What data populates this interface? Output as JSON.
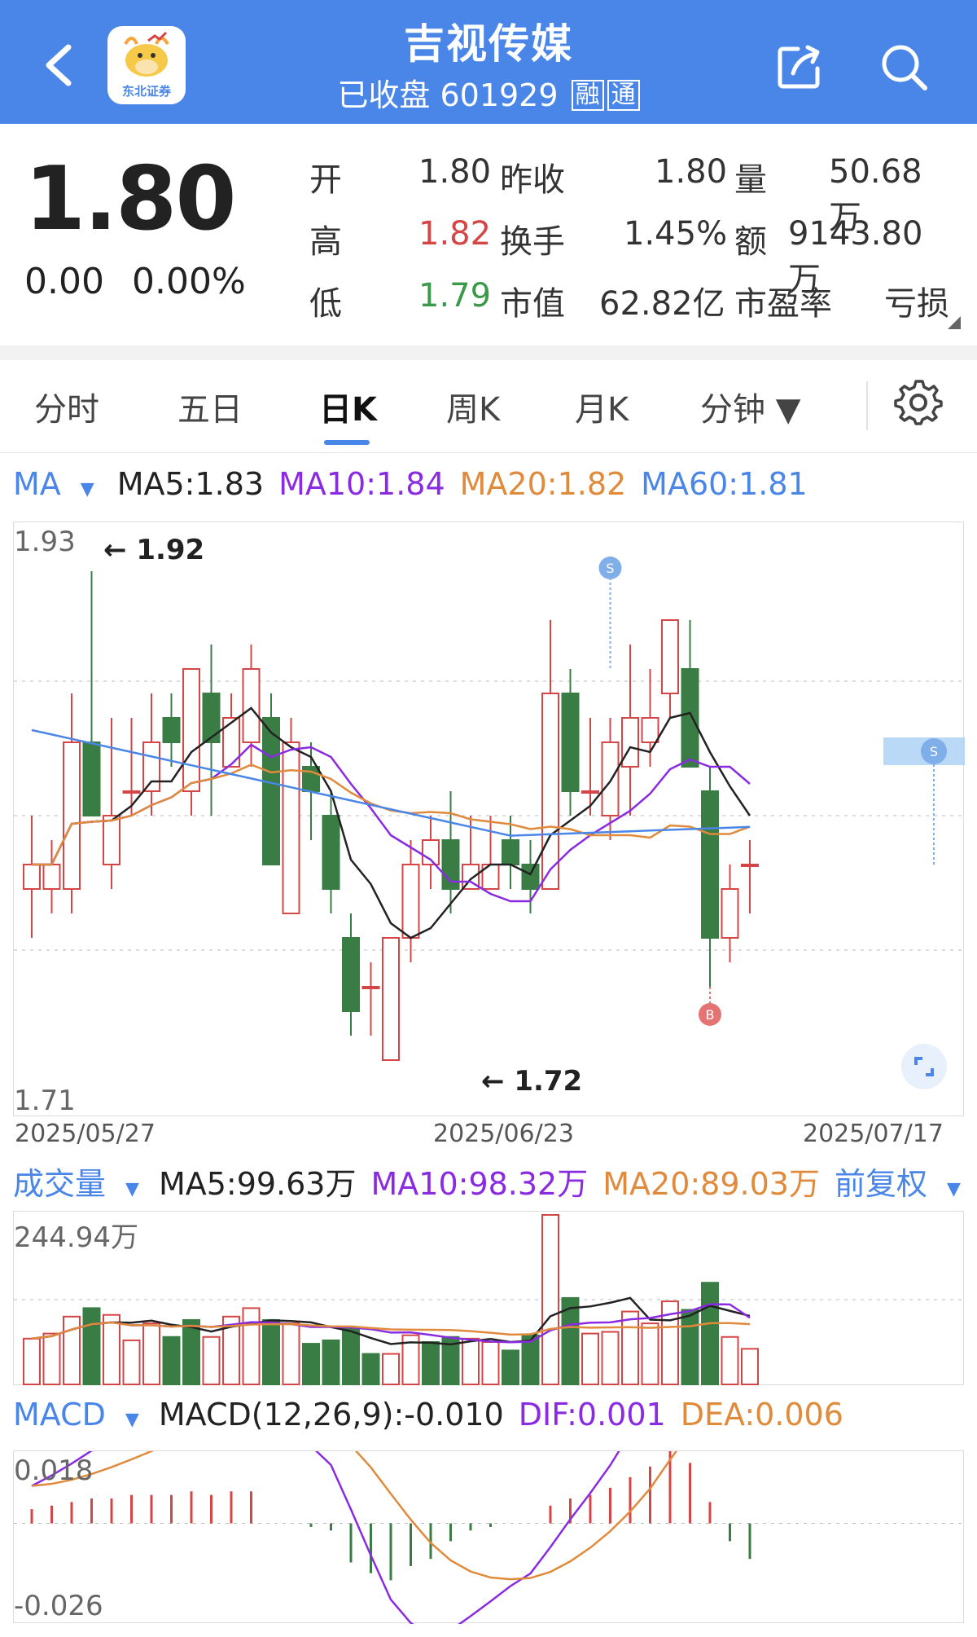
{
  "header": {
    "title": "吉视传媒",
    "status": "已收盘",
    "code": "601929",
    "tag1": "融",
    "tag2": "通",
    "logo_text": "东北证券"
  },
  "quote": {
    "price": "1.80",
    "change": "0.00",
    "change_pct": "0.00%",
    "open_label": "开",
    "open": "1.80",
    "prev_close_label": "昨收",
    "prev_close": "1.80",
    "volume_label": "量",
    "volume": "50.68万",
    "high_label": "高",
    "high": "1.82",
    "turnover_label": "换手",
    "turnover": "1.45%",
    "amount_label": "额",
    "amount": "9143.80万",
    "low_label": "低",
    "low": "1.79",
    "mktcap_label": "市值",
    "mktcap": "62.82亿",
    "pe_label": "市盈率",
    "pe": "亏损"
  },
  "tabs": [
    "分时",
    "五日",
    "日K",
    "周K",
    "月K",
    "分钟 ▼"
  ],
  "colors": {
    "up": "#d64545",
    "down": "#3a7d44",
    "ma5": "#222222",
    "ma10": "#8a2be2",
    "ma20": "#e08a3c",
    "ma60": "#4a86e8",
    "header": "#4a86e8"
  },
  "ma_legend": {
    "label": "MA",
    "ma5": "MA5:1.83",
    "ma10": "MA10:1.84",
    "ma20": "MA20:1.82",
    "ma60": "MA60:1.81"
  },
  "kline": {
    "y_max_label": "1.93",
    "y_min_label": "1.71",
    "high_mark": "1.92",
    "low_mark": "1.72",
    "dates": [
      "2025/05/27",
      "2025/06/23",
      "2025/07/17"
    ],
    "signal_s": "S",
    "signal_b": "B"
  },
  "vol_legend": {
    "label": "成交量",
    "ma5": "MA5:99.63万",
    "ma10": "MA10:98.32万",
    "ma20": "MA20:89.03万",
    "adjust": "前复权"
  },
  "vol": {
    "y_max_label": "244.94万"
  },
  "macd_legend": {
    "label": "MACD",
    "macd": "MACD(12,26,9):-0.010",
    "dif": "DIF:0.001",
    "dea": "DEA:0.006"
  },
  "macd": {
    "y_max_label": "0.018",
    "y_min_label": "-0.026"
  },
  "chart_data": {
    "type": "candlestick",
    "y_range": [
      1.71,
      1.93
    ],
    "candles": [
      {
        "o": 1.79,
        "h": 1.82,
        "l": 1.77,
        "c": 1.8
      },
      {
        "o": 1.79,
        "h": 1.81,
        "l": 1.78,
        "c": 1.8
      },
      {
        "o": 1.79,
        "h": 1.87,
        "l": 1.78,
        "c": 1.85
      },
      {
        "o": 1.85,
        "h": 1.92,
        "l": 1.82,
        "c": 1.82
      },
      {
        "o": 1.8,
        "h": 1.86,
        "l": 1.79,
        "c": 1.82
      },
      {
        "o": 1.83,
        "h": 1.86,
        "l": 1.82,
        "c": 1.83
      },
      {
        "o": 1.83,
        "h": 1.87,
        "l": 1.82,
        "c": 1.85
      },
      {
        "o": 1.86,
        "h": 1.87,
        "l": 1.84,
        "c": 1.85
      },
      {
        "o": 1.83,
        "h": 1.88,
        "l": 1.82,
        "c": 1.88
      },
      {
        "o": 1.87,
        "h": 1.89,
        "l": 1.82,
        "c": 1.85
      },
      {
        "o": 1.84,
        "h": 1.87,
        "l": 1.84,
        "c": 1.86
      },
      {
        "o": 1.85,
        "h": 1.89,
        "l": 1.84,
        "c": 1.88
      },
      {
        "o": 1.86,
        "h": 1.87,
        "l": 1.8,
        "c": 1.8
      },
      {
        "o": 1.78,
        "h": 1.86,
        "l": 1.78,
        "c": 1.85
      },
      {
        "o": 1.84,
        "h": 1.85,
        "l": 1.81,
        "c": 1.83
      },
      {
        "o": 1.82,
        "h": 1.83,
        "l": 1.78,
        "c": 1.79
      },
      {
        "o": 1.77,
        "h": 1.78,
        "l": 1.73,
        "c": 1.74
      },
      {
        "o": 1.75,
        "h": 1.76,
        "l": 1.73,
        "c": 1.75
      },
      {
        "o": 1.72,
        "h": 1.77,
        "l": 1.72,
        "c": 1.77
      },
      {
        "o": 1.77,
        "h": 1.81,
        "l": 1.76,
        "c": 1.8
      },
      {
        "o": 1.8,
        "h": 1.82,
        "l": 1.79,
        "c": 1.81
      },
      {
        "o": 1.81,
        "h": 1.83,
        "l": 1.78,
        "c": 1.79
      },
      {
        "o": 1.79,
        "h": 1.82,
        "l": 1.79,
        "c": 1.8
      },
      {
        "o": 1.79,
        "h": 1.82,
        "l": 1.79,
        "c": 1.8
      },
      {
        "o": 1.81,
        "h": 1.82,
        "l": 1.79,
        "c": 1.8
      },
      {
        "o": 1.8,
        "h": 1.81,
        "l": 1.78,
        "c": 1.79
      },
      {
        "o": 1.79,
        "h": 1.9,
        "l": 1.79,
        "c": 1.87
      },
      {
        "o": 1.87,
        "h": 1.88,
        "l": 1.82,
        "c": 1.83
      },
      {
        "o": 1.83,
        "h": 1.86,
        "l": 1.82,
        "c": 1.83
      },
      {
        "o": 1.82,
        "h": 1.86,
        "l": 1.81,
        "c": 1.85
      },
      {
        "o": 1.84,
        "h": 1.89,
        "l": 1.82,
        "c": 1.86
      },
      {
        "o": 1.85,
        "h": 1.88,
        "l": 1.84,
        "c": 1.86
      },
      {
        "o": 1.87,
        "h": 1.9,
        "l": 1.86,
        "c": 1.9
      },
      {
        "o": 1.88,
        "h": 1.9,
        "l": 1.84,
        "c": 1.84
      },
      {
        "o": 1.83,
        "h": 1.84,
        "l": 1.75,
        "c": 1.77
      },
      {
        "o": 1.77,
        "h": 1.8,
        "l": 1.76,
        "c": 1.79
      },
      {
        "o": 1.8,
        "h": 1.81,
        "l": 1.78,
        "c": 1.8
      }
    ],
    "volume": [
      {
        "v": 0.27,
        "up": true
      },
      {
        "v": 0.3,
        "up": true
      },
      {
        "v": 0.4,
        "up": true
      },
      {
        "v": 0.45,
        "up": false
      },
      {
        "v": 0.41,
        "up": true
      },
      {
        "v": 0.26,
        "up": true
      },
      {
        "v": 0.36,
        "up": true
      },
      {
        "v": 0.28,
        "up": false
      },
      {
        "v": 0.38,
        "up": false
      },
      {
        "v": 0.28,
        "up": true
      },
      {
        "v": 0.4,
        "up": true
      },
      {
        "v": 0.45,
        "up": true
      },
      {
        "v": 0.38,
        "up": false
      },
      {
        "v": 0.36,
        "up": true
      },
      {
        "v": 0.24,
        "up": false
      },
      {
        "v": 0.26,
        "up": false
      },
      {
        "v": 0.33,
        "up": false
      },
      {
        "v": 0.18,
        "up": false
      },
      {
        "v": 0.18,
        "up": true
      },
      {
        "v": 0.29,
        "up": true
      },
      {
        "v": 0.25,
        "up": false
      },
      {
        "v": 0.28,
        "up": false
      },
      {
        "v": 0.27,
        "up": true
      },
      {
        "v": 0.25,
        "up": true
      },
      {
        "v": 0.2,
        "up": false
      },
      {
        "v": 0.29,
        "up": false
      },
      {
        "v": 1.0,
        "up": true
      },
      {
        "v": 0.51,
        "up": false
      },
      {
        "v": 0.3,
        "up": true
      },
      {
        "v": 0.31,
        "up": true
      },
      {
        "v": 0.43,
        "up": true
      },
      {
        "v": 0.36,
        "up": true
      },
      {
        "v": 0.49,
        "up": true
      },
      {
        "v": 0.44,
        "up": false
      },
      {
        "v": 0.6,
        "up": false
      },
      {
        "v": 0.28,
        "up": true
      },
      {
        "v": 0.21,
        "up": true
      }
    ],
    "macd_bars": [
      0.004,
      0.005,
      0.006,
      0.007,
      0.007,
      0.008,
      0.008,
      0.008,
      0.009,
      0.008,
      0.009,
      0.009,
      0.0,
      0.0,
      -0.001,
      -0.002,
      -0.011,
      -0.014,
      -0.016,
      -0.012,
      -0.01,
      -0.005,
      -0.002,
      -0.001,
      0.0,
      0.0,
      0.005,
      0.007,
      0.008,
      0.01,
      0.013,
      0.016,
      0.023,
      0.017,
      0.006,
      -0.005,
      -0.01
    ],
    "macd_range": [
      -0.026,
      0.018
    ]
  }
}
